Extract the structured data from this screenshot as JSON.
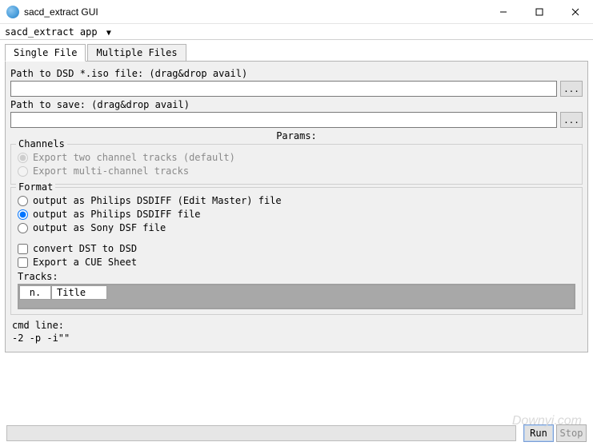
{
  "window": {
    "title": "sacd_extract GUI"
  },
  "menu": {
    "app_label": "sacd_extract app"
  },
  "tabs": {
    "single": "Single File",
    "multiple": "Multiple Files"
  },
  "fields": {
    "iso_label": "Path to DSD *.iso file: (drag&drop avail)",
    "iso_value": "",
    "save_label": "Path to save: (drag&drop avail)",
    "save_value": "",
    "browse": "...",
    "params": "Params:"
  },
  "channels": {
    "legend": "Channels",
    "two": "Export two channel tracks (default)",
    "multi": "Export multi-channel tracks"
  },
  "format": {
    "legend": "Format",
    "opt1": "output as Philips DSDIFF (Edit Master) file",
    "opt2": "output as Philips DSDIFF file",
    "opt3": "output as Sony DSF file",
    "convert": "convert DST to DSD",
    "cue": "Export a CUE Sheet"
  },
  "tracks": {
    "label": "Tracks:",
    "col_n": "n.",
    "col_title": "Title"
  },
  "cmdline": {
    "label": "cmd line:",
    "value": "-2 -p  -i\"\""
  },
  "buttons": {
    "run": "Run",
    "stop": "Stop"
  },
  "watermark": "Downyi.com"
}
